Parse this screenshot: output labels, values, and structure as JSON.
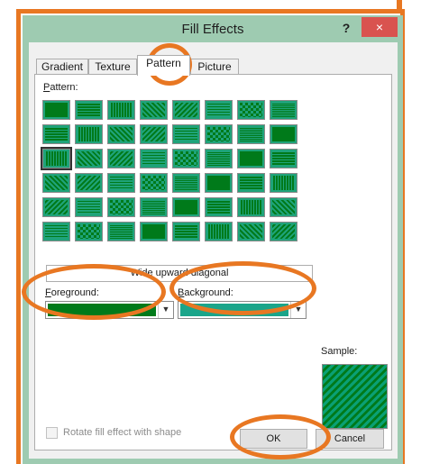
{
  "window": {
    "title": "Fill Effects",
    "help_glyph": "?",
    "close_glyph": "×"
  },
  "tabs": [
    {
      "label": "Gradient"
    },
    {
      "label": "Texture"
    },
    {
      "label": "Pattern",
      "selected": true
    },
    {
      "label": "Picture"
    }
  ],
  "pattern": {
    "label": "Pattern:",
    "selected_name": "Wide upward diagonal",
    "selected_index": 16
  },
  "foreground": {
    "label": "Foreground:",
    "color": "#007a1a"
  },
  "background": {
    "label": "Background:",
    "color": "#1aa58a"
  },
  "sample": {
    "label": "Sample:"
  },
  "rotate_option": {
    "label": "Rotate fill effect with shape",
    "checked": false,
    "enabled": false
  },
  "buttons": {
    "ok": "OK",
    "cancel": "Cancel"
  },
  "colors": {
    "annotation": "#e87722",
    "title_bar": "#9ecbb1",
    "close_button": "#d9534f",
    "swatch_primary": "#1fa37a",
    "swatch_secondary": "#007a1a"
  }
}
